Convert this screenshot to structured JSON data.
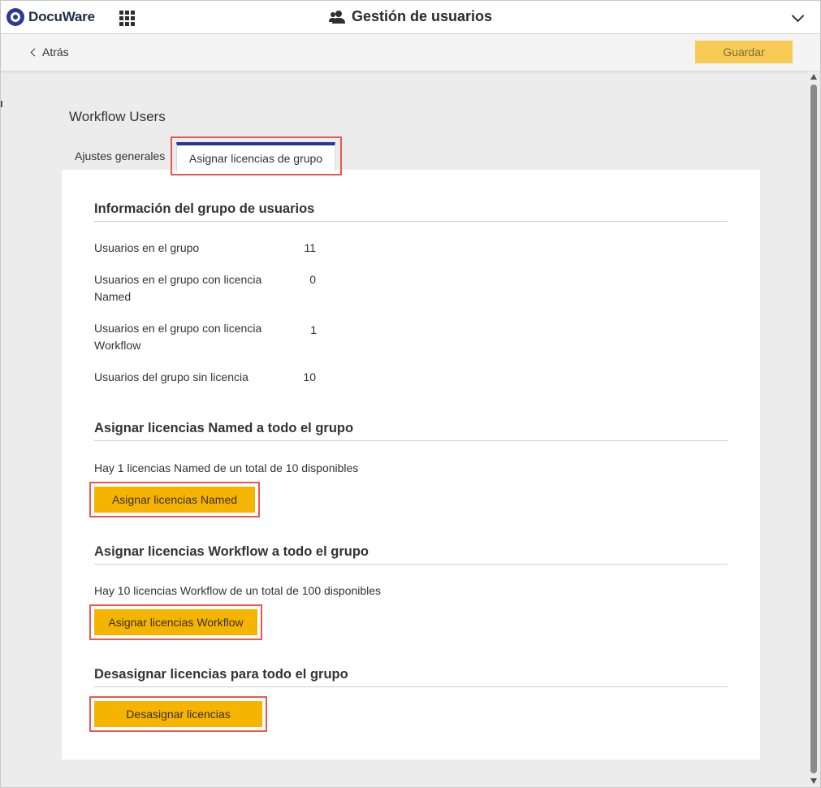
{
  "header": {
    "brand": "DocuWare",
    "title": "Gestión de usuarios"
  },
  "toolbar": {
    "back_label": "Atrás",
    "save_label": "Guardar"
  },
  "page": {
    "title": "Workflow Users",
    "tabs": [
      {
        "label": "Ajustes generales",
        "active": false
      },
      {
        "label": "Asignar licencias de grupo",
        "active": true
      }
    ]
  },
  "group_info": {
    "heading": "Información del grupo de usuarios",
    "rows": [
      {
        "label_line1": "Usuarios en el grupo",
        "label_line2": "",
        "value": "11"
      },
      {
        "label_line1": "Usuarios en el grupo con licencia",
        "label_line2": "Named",
        "value": "0"
      },
      {
        "label_line1": "Usuarios en el grupo con licencia",
        "label_line2": "Workflow",
        "value": "1"
      },
      {
        "label_line1": "Usuarios del grupo sin licencia",
        "label_line2": "",
        "value": "10"
      }
    ]
  },
  "named": {
    "heading": "Asignar licencias Named a todo el grupo",
    "info": "Hay 1 licencias Named de un total de 10 disponibles",
    "button": "Asignar licencias Named"
  },
  "workflow": {
    "heading": "Asignar licencias Workflow a todo el grupo",
    "info": "Hay 10 licencias Workflow de un total de 100 disponibles",
    "button": "Asignar licencias Workflow"
  },
  "unassign": {
    "heading": "Desasignar licencias para todo el grupo",
    "button": "Desasignar licencias"
  },
  "colors": {
    "accent_blue": "#26359e",
    "button_yellow": "#f5b400",
    "save_disabled_yellow": "#f8cc54",
    "highlight_red": "#e8584f"
  }
}
